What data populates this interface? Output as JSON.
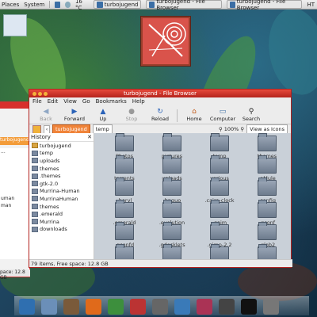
{
  "top_panel": {
    "items": [
      "Places",
      "System"
    ],
    "temperature": "16 °C",
    "tasks": [
      "turbojugend",
      "turbojugend - File Browser",
      "turbojugend - File Browser"
    ],
    "right_text": "HT"
  },
  "file_browser": {
    "title": "turbojugend - File Browser",
    "menu": [
      "File",
      "Edit",
      "View",
      "Go",
      "Bookmarks",
      "Help"
    ],
    "toolbar": {
      "back": "Back",
      "forward": "Forward",
      "up": "Up",
      "stop": "Stop",
      "reload": "Reload",
      "home": "Home",
      "computer": "Computer",
      "search": "Search"
    },
    "location": {
      "crumbs": [
        "turbojugend",
        "temp"
      ],
      "zoom": "100%",
      "view_as": "View as Icons"
    },
    "sidebar": {
      "title": "History",
      "items": [
        "turbojugend",
        "temp",
        "uploads",
        "themes",
        ".themes",
        "gtk-2.0",
        "Murrina-Human",
        "MurrinaHuman",
        "themes",
        ".emerald",
        "Murrina",
        "downloads"
      ]
    },
    "grid": {
      "items": [
        "Photos",
        "pictures",
        "temp",
        "themes",
        "torrents",
        "uploads",
        "various",
        ".aMule",
        ".beryl",
        ".bnquo",
        ".cairo-clock",
        ".config",
        ".emerald",
        ".evolution",
        ".gaim",
        ".gconf",
        ".gconfd",
        ".gdesklets",
        ".gimp-2.2",
        ".glob2",
        "",
        "",
        "",
        ""
      ]
    },
    "status": "79 items, Free space: 12.8 GB"
  },
  "back_window": {
    "crumb": "turbojugend",
    "sidebar": [
      "...",
      "uman",
      "man"
    ],
    "status": "pace: 12.8 GB"
  },
  "dock": {
    "items": [
      "desktop",
      "files",
      "terminal-docs",
      "firefox",
      "update",
      "chat",
      "audio",
      "screenshot",
      "archive",
      "media",
      "terminal",
      "settings"
    ]
  },
  "colors": {
    "accent": "#d7302c",
    "crumb_active": "#f0843a",
    "grid_bg": "#c9d0d8"
  }
}
